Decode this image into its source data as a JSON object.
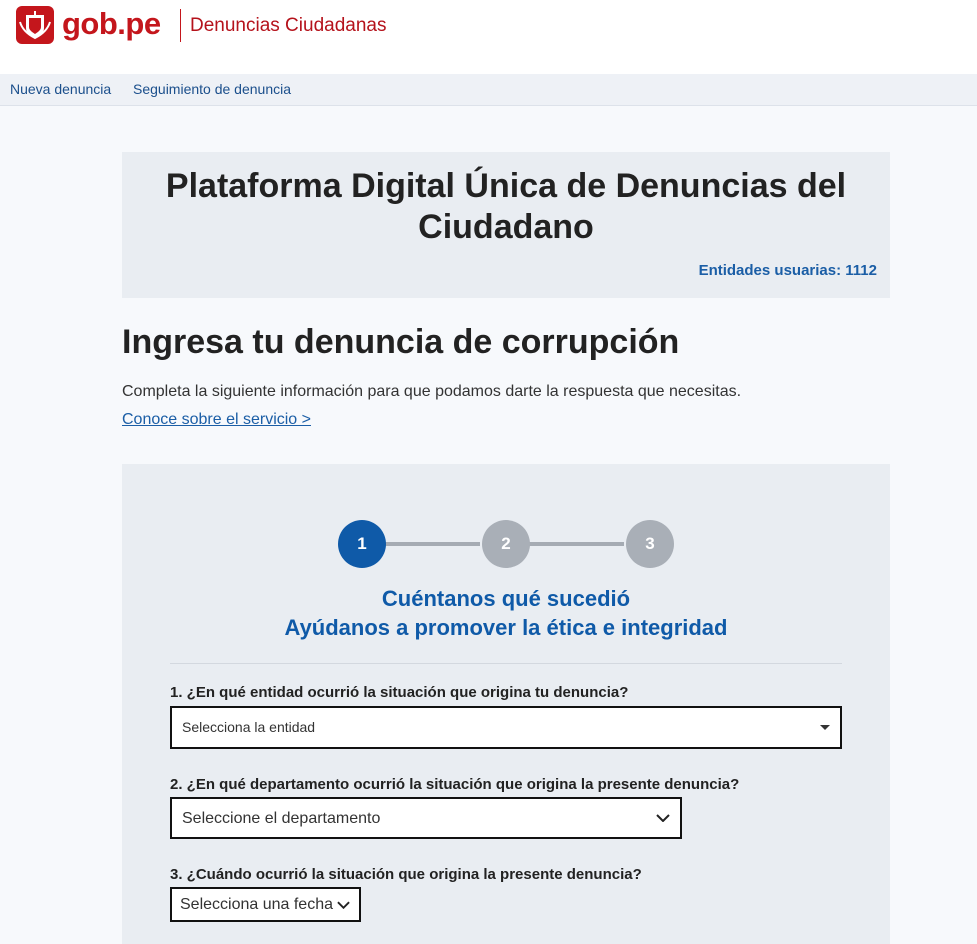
{
  "header": {
    "logo_text": "gob.pe",
    "site_title": "Denuncias Ciudadanas"
  },
  "nav": {
    "items": [
      {
        "label": "Nueva denuncia"
      },
      {
        "label": "Seguimiento de denuncia"
      }
    ]
  },
  "banner": {
    "title": "Plataforma Digital Única de Denuncias del Ciudadano",
    "entities": "Entidades usuarias: 1112"
  },
  "page": {
    "heading": "Ingresa tu denuncia de corrupción",
    "description": "Completa la siguiente información para que podamos darte la respuesta que necesitas.",
    "link": "Conoce sobre el servicio >"
  },
  "stepper": {
    "steps": [
      "1",
      "2",
      "3"
    ],
    "current": 1,
    "title": "Cuéntanos qué sucedió",
    "subtitle": "Ayúdanos a promover la ética e integridad"
  },
  "form": {
    "q1": {
      "label": "1. ¿En qué entidad ocurrió la situación que origina tu denuncia?",
      "value": "Selecciona la entidad"
    },
    "q2": {
      "label": "2. ¿En qué departamento ocurrió la situación que origina la presente denuncia?",
      "value": "Seleccione el departamento"
    },
    "q3": {
      "label": "3. ¿Cuándo ocurrió la situación que origina la presente denuncia?",
      "value": "Selecciona una fecha"
    }
  },
  "colors": {
    "brand_red": "#c4161c",
    "link_blue": "#1b5ea6",
    "step_active": "#0f5aa8",
    "step_inactive": "#a9afb7"
  },
  "icons": [
    "peru-coat-of-arms-icon",
    "caret-down-icon",
    "chevron-down-icon"
  ]
}
